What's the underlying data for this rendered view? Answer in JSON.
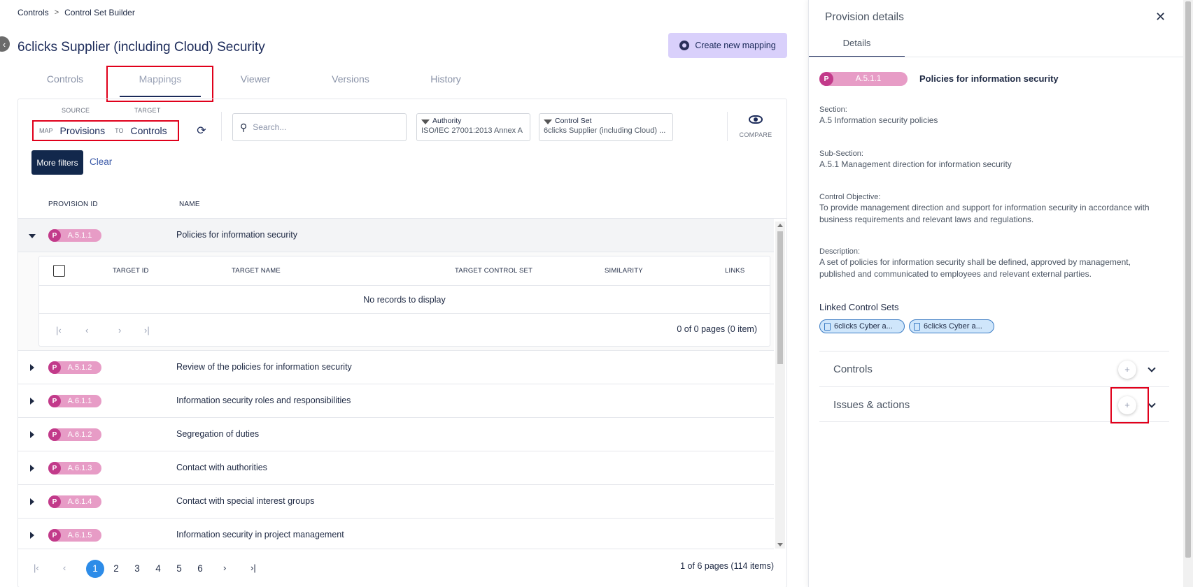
{
  "breadcrumb": {
    "items": [
      "Controls",
      "Control Set Builder"
    ],
    "separator": ">"
  },
  "back_icon": "back-arrow-icon",
  "page_title": "6clicks Supplier (including Cloud) Security",
  "create_mapping_label": "Create new mapping",
  "tabs": [
    "Controls",
    "Mappings",
    "Viewer",
    "Versions",
    "History"
  ],
  "active_tab": "Mappings",
  "map": {
    "source_label": "SOURCE",
    "target_label": "TARGET",
    "map_word": "MAP",
    "to_word": "TO",
    "source_value": "Provisions",
    "target_value": "Controls"
  },
  "search": {
    "placeholder": "Search..."
  },
  "filters": {
    "authority": {
      "label": "Authority",
      "value": "ISO/IEC 27001:2013 Annex A"
    },
    "control_set": {
      "label": "Control Set",
      "value": "6clicks Supplier (including Cloud) ..."
    }
  },
  "compare_label": "COMPARE",
  "more_filters_label": "More filters",
  "clear_label": "Clear",
  "table": {
    "headers": {
      "provision_id": "PROVISION ID",
      "name": "NAME"
    },
    "badge_letter": "P",
    "rows": [
      {
        "id": "A.5.1.1",
        "name": "Policies for information security",
        "expanded": true
      },
      {
        "id": "A.5.1.2",
        "name": "Review of the policies for information security"
      },
      {
        "id": "A.6.1.1",
        "name": "Information security roles and responsibilities"
      },
      {
        "id": "A.6.1.2",
        "name": "Segregation of duties"
      },
      {
        "id": "A.6.1.3",
        "name": "Contact with authorities"
      },
      {
        "id": "A.6.1.4",
        "name": "Contact with special interest groups"
      },
      {
        "id": "A.6.1.5",
        "name": "Information security in project management"
      }
    ]
  },
  "subtable": {
    "headers": [
      "TARGET ID",
      "TARGET NAME",
      "TARGET CONTROL SET",
      "SIMILARITY",
      "LINKS"
    ],
    "empty_text": "No records to display",
    "pager_info": "0 of 0 pages (0 item)"
  },
  "pagination": {
    "pages": [
      "1",
      "2",
      "3",
      "4",
      "5",
      "6"
    ],
    "current": "1",
    "info": "1 of 6 pages (114 items)"
  },
  "details": {
    "title": "Provision details",
    "tab": "Details",
    "badge_letter": "P",
    "provision_id": "A.5.1.1",
    "provision_name": "Policies for information security",
    "section_label": "Section:",
    "section": "A.5 Information security policies",
    "subsection_label": "Sub-Section:",
    "subsection": "A.5.1 Management direction for information security",
    "objective_label": "Control Objective:",
    "objective": "To provide management direction and support for information security in accordance with business requirements and relevant laws and regulations.",
    "description_label": "Description:",
    "description": "A set of policies for information security shall be defined, approved by management, published and communicated to employees and relevant external parties.",
    "linked_title": "Linked Control Sets",
    "linked_sets": [
      "6clicks Cyber a...",
      "6clicks Cyber a..."
    ],
    "accordions": [
      "Controls",
      "Issues & actions"
    ]
  }
}
